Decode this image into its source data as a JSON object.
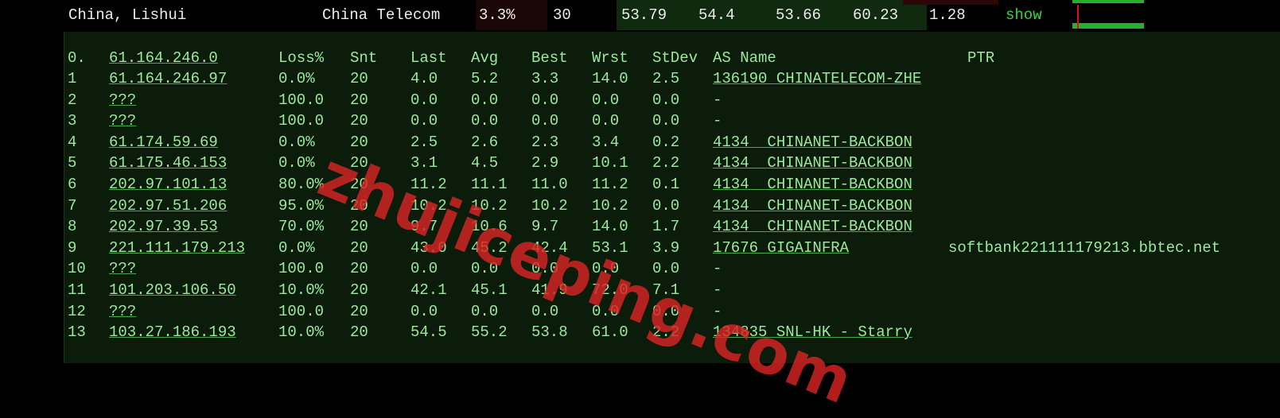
{
  "top_row": {
    "location": "China, Lishui",
    "isp": "China Telecom",
    "loss": "3.3%",
    "sent": "30",
    "last": "53.79",
    "avg": "54.4",
    "best": "53.66",
    "worst": "60.23",
    "stdev": "1.28",
    "show_label": "show"
  },
  "headers": {
    "hop": "0.",
    "host": "61.164.246.0",
    "loss": "Loss%",
    "snt": "Snt",
    "last": "Last",
    "avg": "Avg",
    "best": "Best",
    "wrst": "Wrst",
    "stdev": "StDev",
    "as_name": "AS Name",
    "ptr": "PTR"
  },
  "rows": [
    {
      "hop": "1",
      "host": "61.164.246.97",
      "loss": "0.0%",
      "snt": "20",
      "last": "4.0",
      "avg": "5.2",
      "best": "3.3",
      "wrst": "14.0",
      "stdev": "2.5",
      "as_name": "136190 CHINATELECOM-ZHE",
      "ptr": ""
    },
    {
      "hop": "2",
      "host": "???",
      "loss": "100.0",
      "snt": "20",
      "last": "0.0",
      "avg": "0.0",
      "best": "0.0",
      "wrst": "0.0",
      "stdev": "0.0",
      "as_name": "-",
      "ptr": ""
    },
    {
      "hop": "3",
      "host": "???",
      "loss": "100.0",
      "snt": "20",
      "last": "0.0",
      "avg": "0.0",
      "best": "0.0",
      "wrst": "0.0",
      "stdev": "0.0",
      "as_name": "-",
      "ptr": ""
    },
    {
      "hop": "4",
      "host": "61.174.59.69",
      "loss": "0.0%",
      "snt": "20",
      "last": "2.5",
      "avg": "2.6",
      "best": "2.3",
      "wrst": "3.4",
      "stdev": "0.2",
      "as_name": "4134  CHINANET-BACKBON",
      "ptr": ""
    },
    {
      "hop": "5",
      "host": "61.175.46.153",
      "loss": "0.0%",
      "snt": "20",
      "last": "3.1",
      "avg": "4.5",
      "best": "2.9",
      "wrst": "10.1",
      "stdev": "2.2",
      "as_name": "4134  CHINANET-BACKBON",
      "ptr": ""
    },
    {
      "hop": "6",
      "host": "202.97.101.13",
      "loss": "80.0%",
      "snt": "20",
      "last": "11.2",
      "avg": "11.1",
      "best": "11.0",
      "wrst": "11.2",
      "stdev": "0.1",
      "as_name": "4134  CHINANET-BACKBON",
      "ptr": ""
    },
    {
      "hop": "7",
      "host": "202.97.51.206",
      "loss": "95.0%",
      "snt": "20",
      "last": "10.2",
      "avg": "10.2",
      "best": "10.2",
      "wrst": "10.2",
      "stdev": "0.0",
      "as_name": "4134  CHINANET-BACKBON",
      "ptr": ""
    },
    {
      "hop": "8",
      "host": "202.97.39.53",
      "loss": "70.0%",
      "snt": "20",
      "last": "9.7",
      "avg": "10.6",
      "best": "9.7",
      "wrst": "14.0",
      "stdev": "1.7",
      "as_name": "4134  CHINANET-BACKBON",
      "ptr": ""
    },
    {
      "hop": "9",
      "host": "221.111.179.213",
      "loss": "0.0%",
      "snt": "20",
      "last": "43.0",
      "avg": "45.2",
      "best": "42.4",
      "wrst": "53.1",
      "stdev": "3.9",
      "as_name": "17676 GIGAINFRA",
      "ptr": "softbank221111179213.bbtec.net"
    },
    {
      "hop": "10",
      "host": "???",
      "loss": "100.0",
      "snt": "20",
      "last": "0.0",
      "avg": "0.0",
      "best": "0.0",
      "wrst": "0.0",
      "stdev": "0.0",
      "as_name": "-",
      "ptr": ""
    },
    {
      "hop": "11",
      "host": "101.203.106.50",
      "loss": "10.0%",
      "snt": "20",
      "last": "42.1",
      "avg": "45.1",
      "best": "41.9",
      "wrst": "72.0",
      "stdev": "7.1",
      "as_name": "-",
      "ptr": ""
    },
    {
      "hop": "12",
      "host": "???",
      "loss": "100.0",
      "snt": "20",
      "last": "0.0",
      "avg": "0.0",
      "best": "0.0",
      "wrst": "0.0",
      "stdev": "0.0",
      "as_name": "-",
      "ptr": ""
    },
    {
      "hop": "13",
      "host": "103.27.186.193",
      "loss": "10.0%",
      "snt": "20",
      "last": "54.5",
      "avg": "55.2",
      "best": "53.8",
      "wrst": "61.0",
      "stdev": "2.2",
      "as_name": "134835 SNL-HK - Starry",
      "ptr": ""
    }
  ],
  "watermark": "zhujiceping.com",
  "colors": {
    "text": "#9ee89e",
    "link": "#34d534",
    "panel_bg": "#0b1c0b",
    "watermark": "#d72323"
  }
}
